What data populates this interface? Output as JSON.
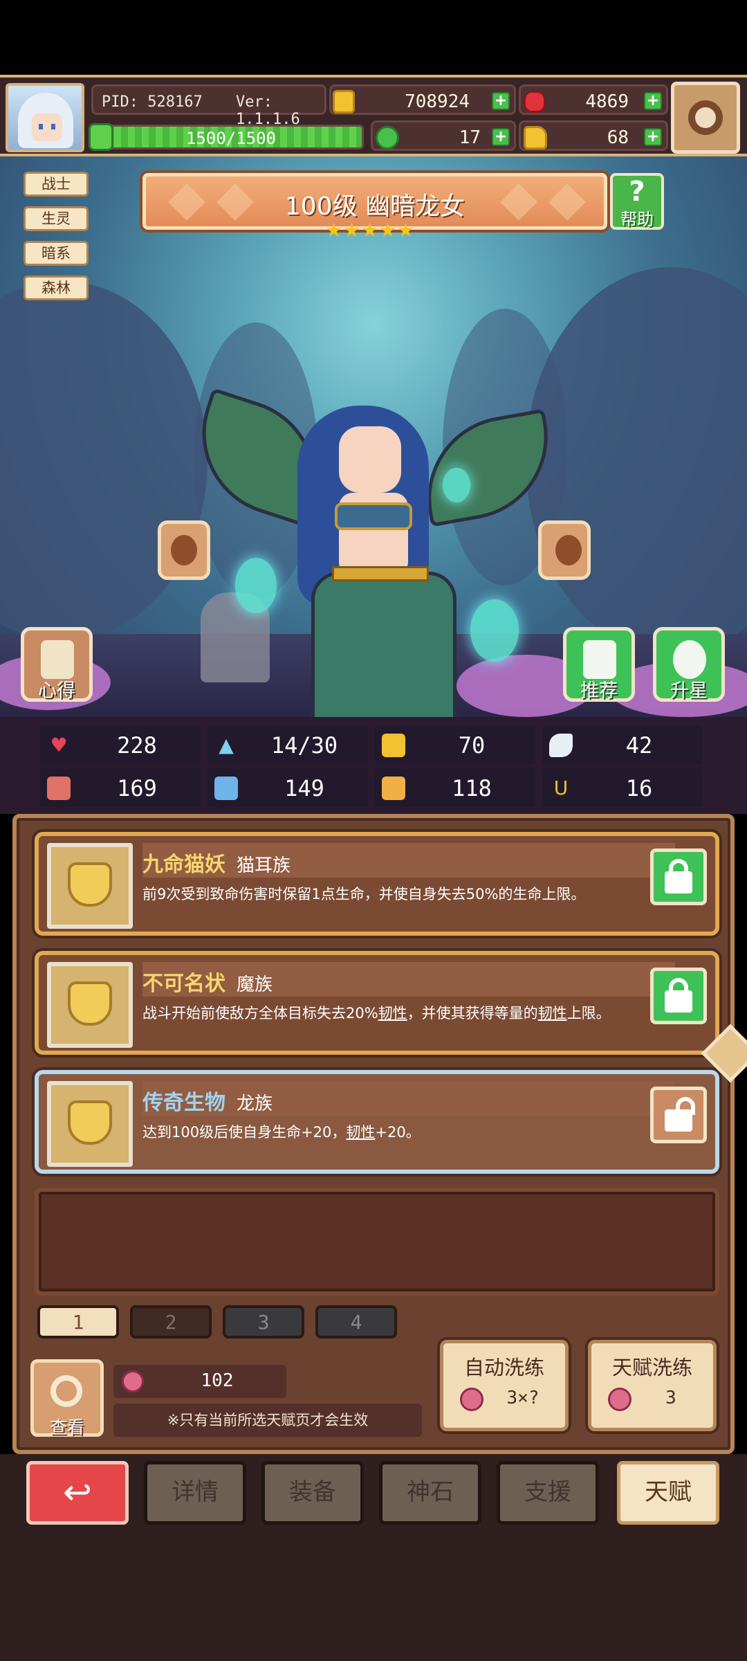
{
  "header": {
    "pid": "PID: 528167",
    "version": "Ver: 1.1.1.6",
    "gold": "708924",
    "ruby": "4869",
    "exp": "1500/1500",
    "exp_fraction": 1.0,
    "green_currency": "17",
    "yellow_currency": "68"
  },
  "hero": {
    "tags": [
      "战士",
      "生灵",
      "暗系",
      "森林"
    ],
    "title": "100级 幽暗龙女",
    "stars": 5,
    "help_label": "帮助",
    "insight_label": "心得",
    "recommend_label": "推荐",
    "upgrade_star_label": "升星"
  },
  "stats": [
    {
      "icon": "heart-icon",
      "value": "228"
    },
    {
      "icon": "water-drop-icon",
      "value": "14/30"
    },
    {
      "icon": "shield-icon",
      "value": "70"
    },
    {
      "icon": "wing-icon",
      "value": "42"
    },
    {
      "icon": "fist-icon",
      "value": "169"
    },
    {
      "icon": "book-icon",
      "value": "149"
    },
    {
      "icon": "boot-icon",
      "value": "118"
    },
    {
      "icon": "horseshoe-icon",
      "value": "16"
    }
  ],
  "talents": [
    {
      "name": "九命猫妖",
      "race": "猫耳族",
      "desc_pre": "前9次受到致命伤害时保留1点生命，并使自身失去50%的生命上限。",
      "locked": true
    },
    {
      "name": "不可名状",
      "race": "魔族",
      "desc_pre": "战斗开始前使敌方全体目标失去20%",
      "kw1": "韧性",
      "desc_mid": "，并使其获得等量的",
      "kw2": "韧性",
      "desc_post": "上限。",
      "locked": true
    },
    {
      "name": "传奇生物",
      "race": "龙族",
      "desc_pre": "达到100级后使自身生命+20，",
      "kw1": "韧性",
      "desc_post": "+20。",
      "locked": false
    }
  ],
  "page_tabs": [
    "1",
    "2",
    "3",
    "4"
  ],
  "bottom_panel": {
    "inspect_label": "查看",
    "fruit_count": "102",
    "notice": "※只有当前所选天赋页才会生效",
    "auto_wash_label": "自动洗练",
    "auto_wash_cost": "3×?",
    "talent_wash_label": "天赋洗练",
    "talent_wash_cost": "3"
  },
  "nav": {
    "back": "↩",
    "details": "详情",
    "equipment": "装备",
    "godstone": "神石",
    "support": "支援",
    "talent": "天赋"
  }
}
